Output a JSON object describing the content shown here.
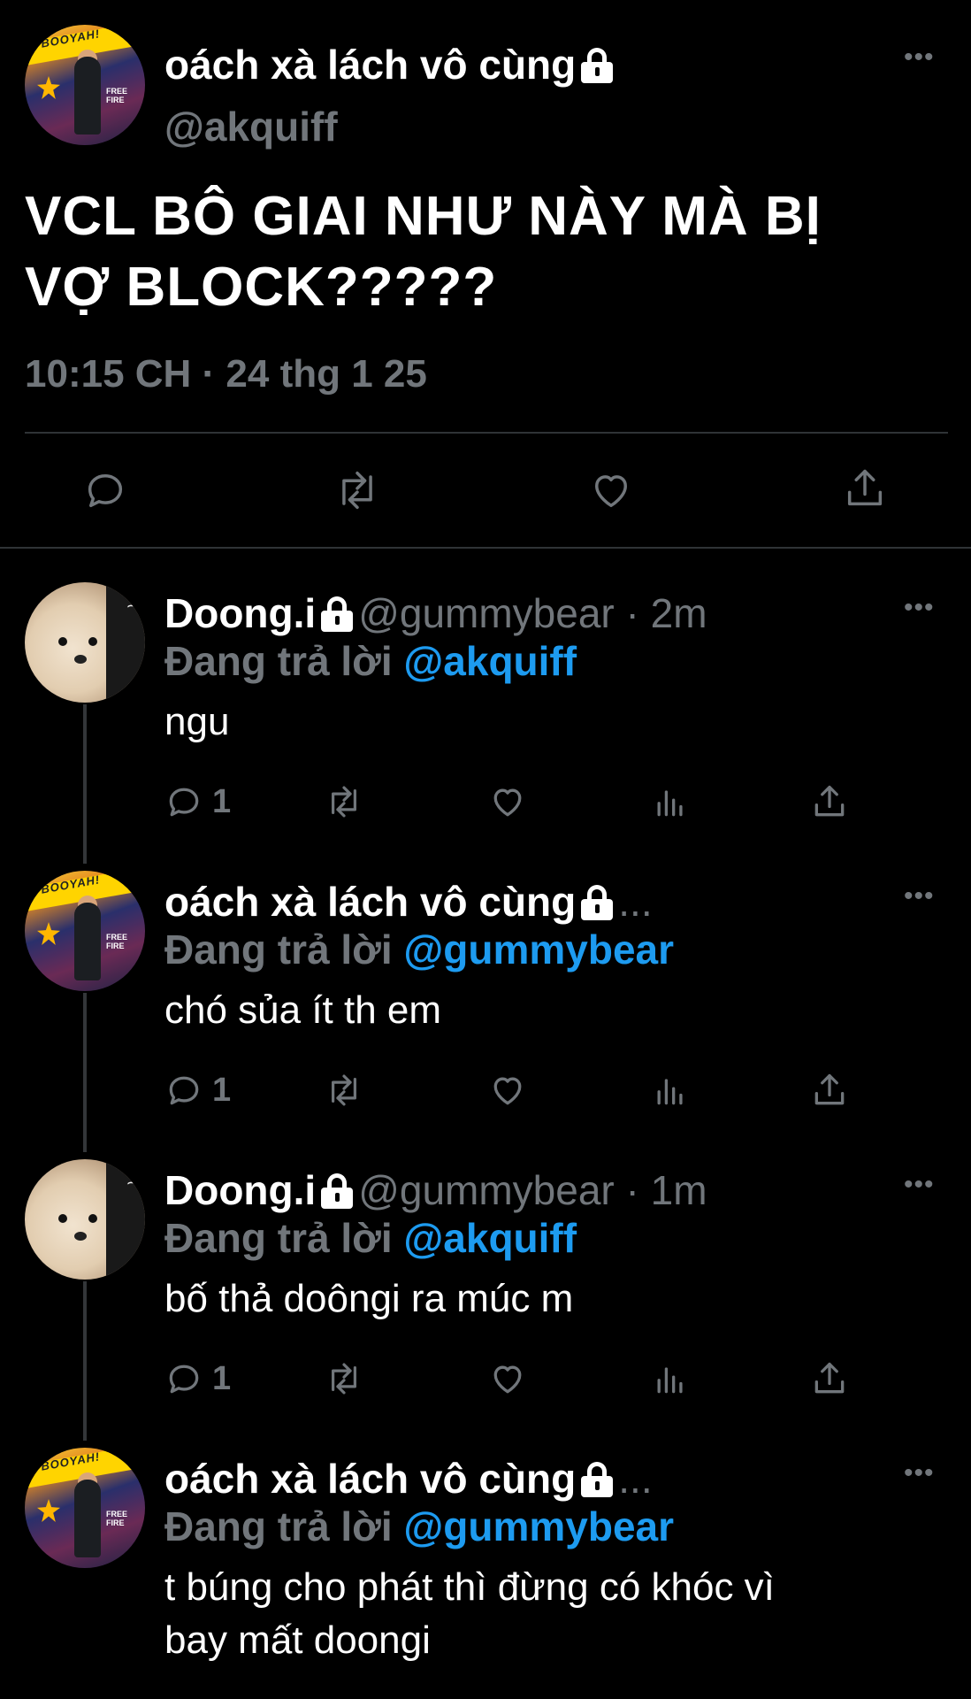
{
  "main_tweet": {
    "author_name": "oách xà lách vô cùng",
    "author_handle": "@akquiff",
    "text_line1": "VCL BÔ GIAI NHƯ NÀY MÀ BỊ",
    "text_line2": "VỢ BLOCK?????",
    "timestamp": "10:15 CH · 24 thg 1 25",
    "more_label": "•••"
  },
  "replies": [
    {
      "author_name": "Doong.i",
      "author_handle": "@gummybear · 2m",
      "replying_prefix": "Đang trả lời ",
      "replying_to": "@akquiff",
      "text": "ngu",
      "reply_count": "1"
    },
    {
      "author_name": "oách xà lách vô cùng",
      "author_handle": "...",
      "replying_prefix": "Đang trả lời ",
      "replying_to": "@gummybear",
      "text": "chó sủa ít th em",
      "reply_count": "1"
    },
    {
      "author_name": "Doong.i",
      "author_handle": "@gummybear · 1m",
      "replying_prefix": "Đang trả lời ",
      "replying_to": "@akquiff",
      "text": "bố thả doôngi ra múc m",
      "reply_count": "1"
    },
    {
      "author_name": "oách xà lách vô cùng",
      "author_handle": "...",
      "replying_prefix": "Đang trả lời ",
      "replying_to": "@gummybear",
      "text_line1": "t búng cho phát thì đừng có khóc vì",
      "text_line2": "bay mất doongi"
    }
  ],
  "avatar_labels": {
    "banner": "BOOYAH!",
    "game": "FREE FIRE"
  },
  "colors": {
    "background": "#000000",
    "text": "#ffffff",
    "secondary": "#71767b",
    "link": "#1d9bf0",
    "divider": "#2f3336"
  },
  "icons": [
    "comment-icon",
    "retweet-icon",
    "like-icon",
    "share-icon",
    "views-icon",
    "lock-icon",
    "more-icon"
  ]
}
